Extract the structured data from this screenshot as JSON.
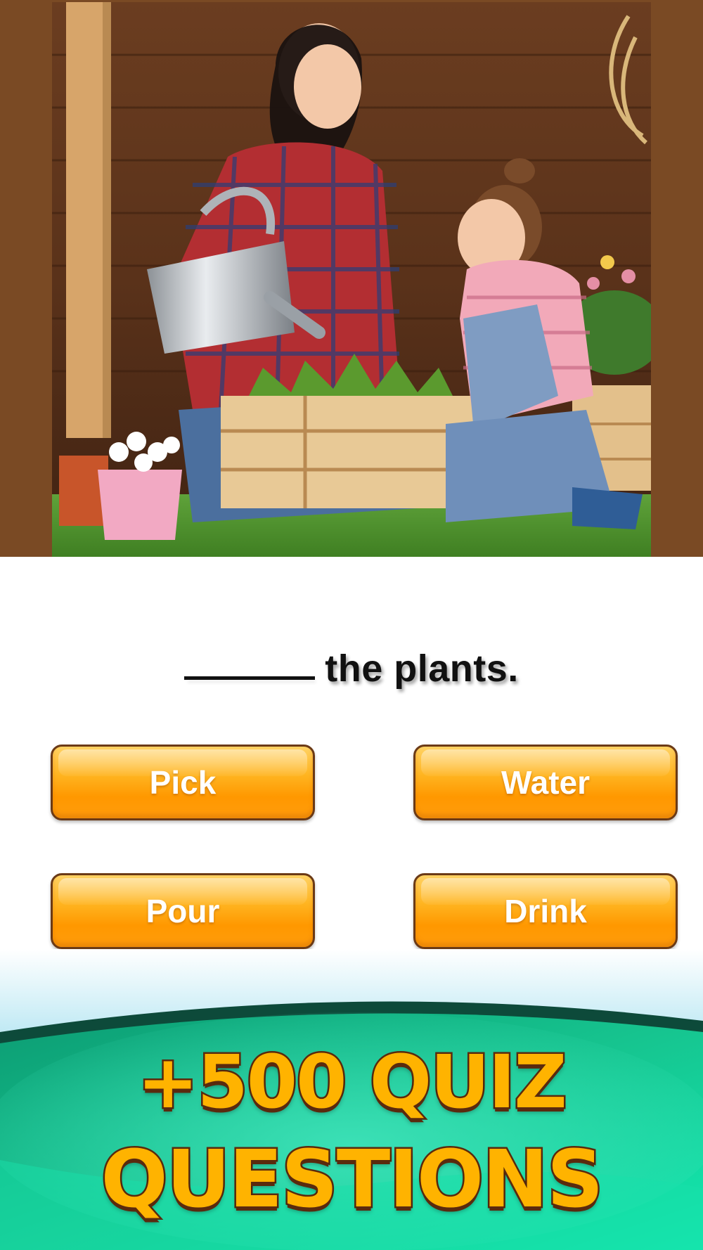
{
  "quiz": {
    "sentence_rest": "the plants.",
    "answers": [
      "Pick",
      "Water",
      "Pour",
      "Drink"
    ]
  },
  "promo": {
    "line1": "+500 QUIZ",
    "line2": "QUESTIONS"
  },
  "colors": {
    "frame_brown": "#7a4a24",
    "button_orange": "#ff9800",
    "button_border": "#6b3a16",
    "banner_green": "#14d6a0",
    "promo_text": "#ffb300",
    "promo_outline": "#5a2a0e"
  }
}
